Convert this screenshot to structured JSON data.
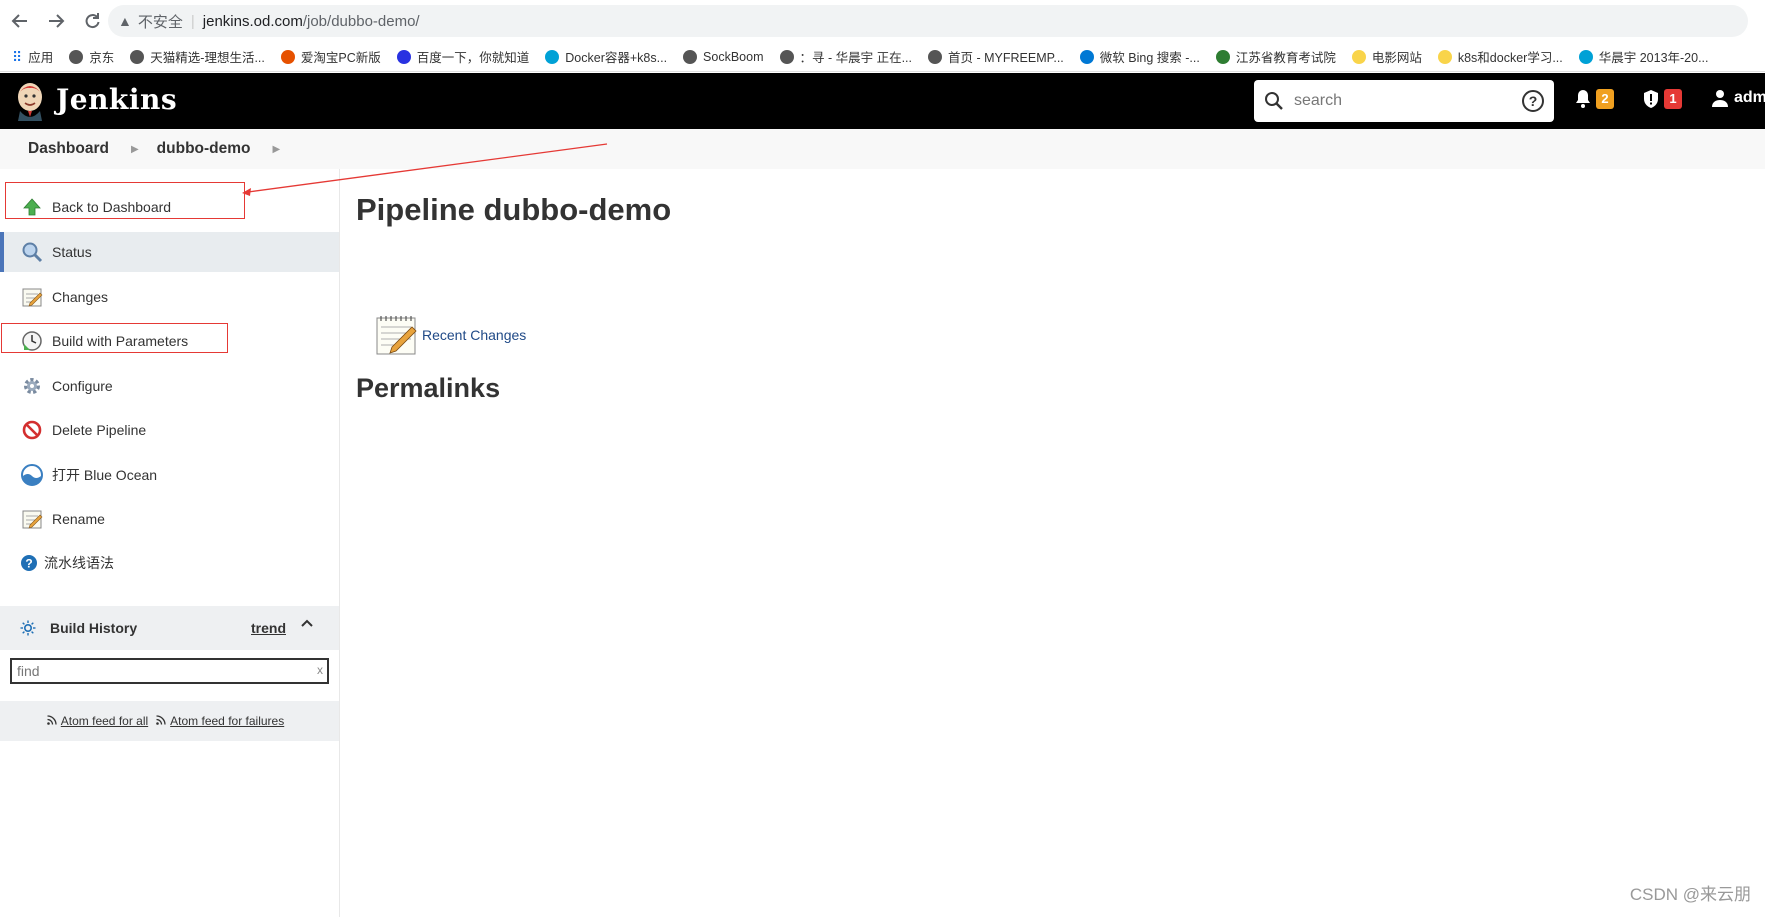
{
  "browser": {
    "insecure_label": "不安全",
    "url_host": "jenkins.od.com",
    "url_path": "/job/dubbo-demo/",
    "bookmarks": [
      {
        "label": "应用",
        "color": "#1a73e8"
      },
      {
        "label": "京东",
        "color": "#555555"
      },
      {
        "label": "天猫精选-理想生活...",
        "color": "#555555"
      },
      {
        "label": "爱淘宝PC新版",
        "color": "#e65100"
      },
      {
        "label": "百度一下，你就知道",
        "color": "#2932e1"
      },
      {
        "label": "Docker容器+k8s...",
        "color": "#00a1d6"
      },
      {
        "label": "SockBoom",
        "color": "#555555"
      },
      {
        "label": "：寻 - 华晨宇 正在...",
        "color": "#555555"
      },
      {
        "label": "首页 - MYFREEMP...",
        "color": "#555555"
      },
      {
        "label": "微软 Bing 搜索 -...",
        "color": "#0078d4"
      },
      {
        "label": "江苏省教育考试院",
        "color": "#2e7d32"
      },
      {
        "label": "电影网站",
        "color": "#f9d44a"
      },
      {
        "label": "k8s和docker学习...",
        "color": "#f9d44a"
      },
      {
        "label": "华晨宇 2013年-20...",
        "color": "#00a1d6"
      }
    ]
  },
  "header": {
    "title": "Jenkins",
    "search_placeholder": "search",
    "notifications_count": "2",
    "security_count": "1",
    "user_label": "adm",
    "notif_color": "#f0a020",
    "security_color": "#e53935"
  },
  "breadcrumb": {
    "items": [
      "Dashboard",
      "dubbo-demo"
    ]
  },
  "sidebar": {
    "tasks": [
      {
        "label": "Back to Dashboard",
        "icon": "up-arrow-icon"
      },
      {
        "label": "Status",
        "icon": "search-icon"
      },
      {
        "label": "Changes",
        "icon": "notepad-icon"
      },
      {
        "label": "Build with Parameters",
        "icon": "clock-icon"
      },
      {
        "label": "Configure",
        "icon": "gear-icon"
      },
      {
        "label": "Delete Pipeline",
        "icon": "no-entry-icon"
      },
      {
        "label": "打开 Blue Ocean",
        "icon": "blue-ocean-icon"
      },
      {
        "label": "Rename",
        "icon": "notepad-icon"
      },
      {
        "label": "流水线语法",
        "icon": "help-icon"
      }
    ],
    "build_history": {
      "title": "Build History",
      "trend_label": "trend",
      "find_placeholder": "find",
      "clear_label": "x"
    },
    "feeds": {
      "all": "Atom feed for all",
      "failures": "Atom feed for failures"
    }
  },
  "main": {
    "title": "Pipeline dubbo-demo",
    "recent_changes": "Recent Changes",
    "permalinks_heading": "Permalinks"
  },
  "watermark": "CSDN @来云朋"
}
